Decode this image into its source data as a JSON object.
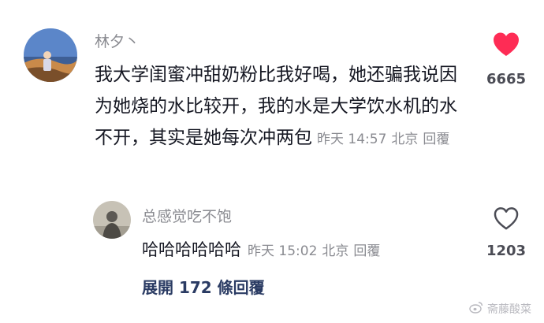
{
  "comment": {
    "username": "林夕丶",
    "text": "我大学闺蜜冲甜奶粉比我好喝，她还骗我说因为她烧的水比较开，我的水是大学饮水机的水不开，其实是她每次冲两包",
    "time": "昨天 14:57",
    "location": "北京",
    "reply_label": "回覆",
    "like_count": "6665",
    "liked": true
  },
  "reply": {
    "username": "总感觉吃不饱",
    "text": "哈哈哈哈哈哈",
    "time": "昨天 15:02",
    "location": "北京",
    "reply_label": "回覆",
    "like_count": "1203",
    "liked": false
  },
  "expand_label": "展開 172 條回覆",
  "watermark": "斋藤酸菜",
  "colors": {
    "heart_active": "#fe2c55",
    "text_primary": "#161823",
    "text_secondary": "#8a8b91",
    "link": "#2a3b63"
  },
  "icons": {
    "like_filled": "heart-filled-icon",
    "like_outline": "heart-outline-icon",
    "watermark": "weibo-icon"
  }
}
